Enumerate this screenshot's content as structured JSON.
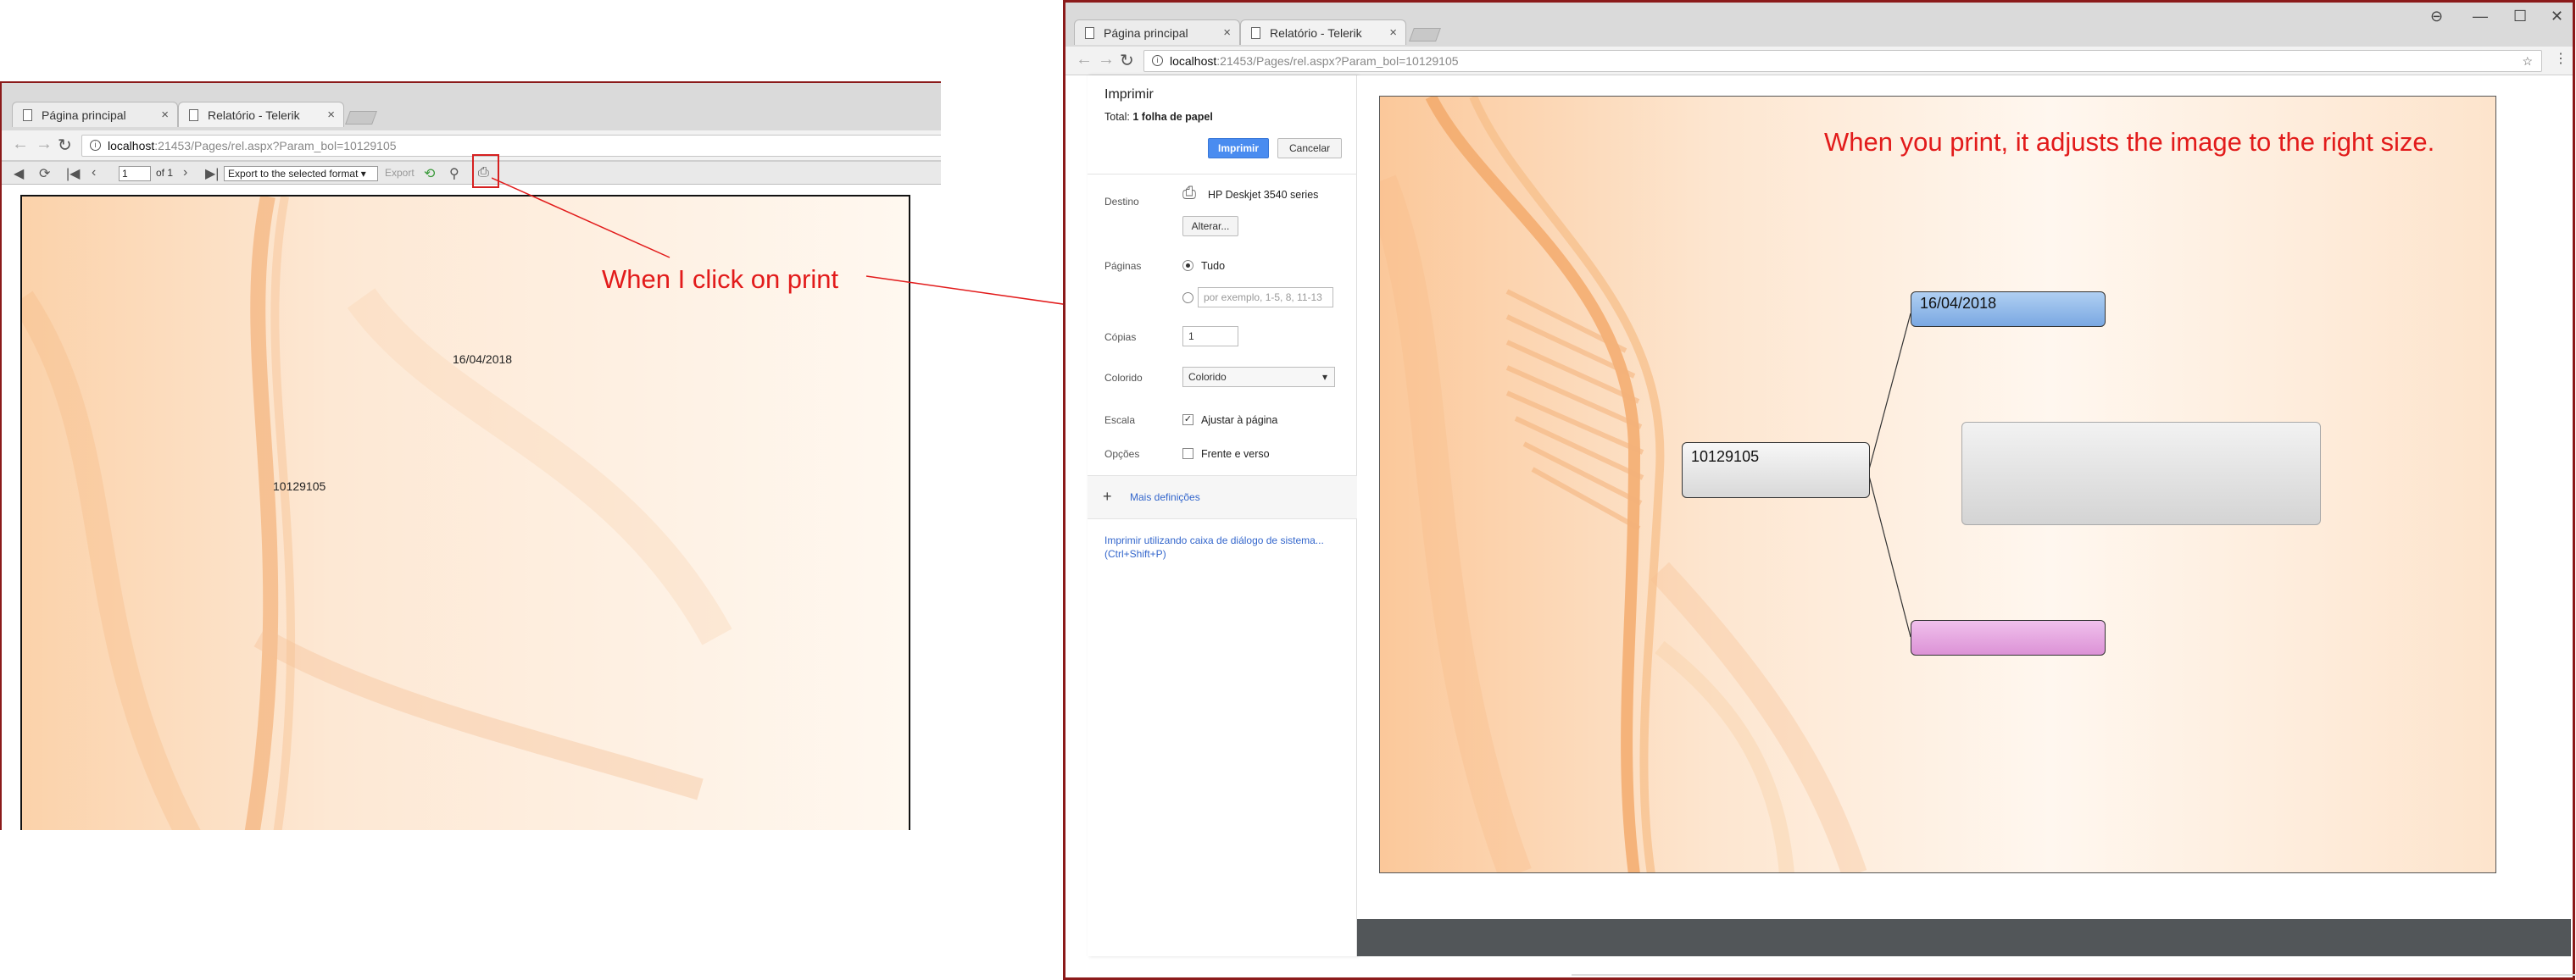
{
  "left_window": {
    "tabs": [
      {
        "label": "Página principal"
      },
      {
        "label": "Relatório - Telerik"
      }
    ],
    "address": {
      "host": "localhost",
      "path": ":21453/Pages/rel.aspx?Param_bol=10129105"
    },
    "toolbar": {
      "page_value": "1",
      "page_of": "of 1",
      "export_select": "Export to the selected format",
      "export_label": "Export"
    },
    "report": {
      "date": "16/04/2018",
      "id": "10129105"
    }
  },
  "annotation": {
    "text": "When I click on print"
  },
  "right_window": {
    "tabs": [
      {
        "label": "Página principal"
      },
      {
        "label": "Relatório - Telerik"
      }
    ],
    "address": {
      "host": "localhost",
      "path": ":21453/Pages/rel.aspx?Param_bol=10129105"
    },
    "print_panel": {
      "title": "Imprimir",
      "total_prefix": "Total: ",
      "total_value": "1 folha de papel",
      "print_button": "Imprimir",
      "cancel_button": "Cancelar",
      "destination_label": "Destino",
      "destination_value": "HP Deskjet 3540 series",
      "change_button": "Alterar...",
      "pages_label": "Páginas",
      "pages_all": "Tudo",
      "pages_placeholder": "por exemplo, 1-5, 8, 11-13",
      "copies_label": "Cópias",
      "copies_value": "1",
      "color_label": "Colorido",
      "color_value": "Colorido",
      "scale_label": "Escala",
      "scale_option": "Ajustar à página",
      "options_label": "Opções",
      "options_option": "Frente e verso",
      "more_settings": "Mais definições",
      "system_dialog": "Imprimir utilizando caixa de diálogo de sistema...",
      "system_dialog_shortcut": "(Ctrl+Shift+P)"
    },
    "preview": {
      "annotation": "When you print, it adjusts the image to the right size.",
      "date": "16/04/2018",
      "id": "10129105"
    }
  },
  "colors": {
    "annotation": "#e21b1b",
    "node_blue": "#8fb8ea",
    "node_pink": "#e6a8e0",
    "node_gray": "#e2e2e2",
    "print_blue": "#4a8cf0"
  }
}
